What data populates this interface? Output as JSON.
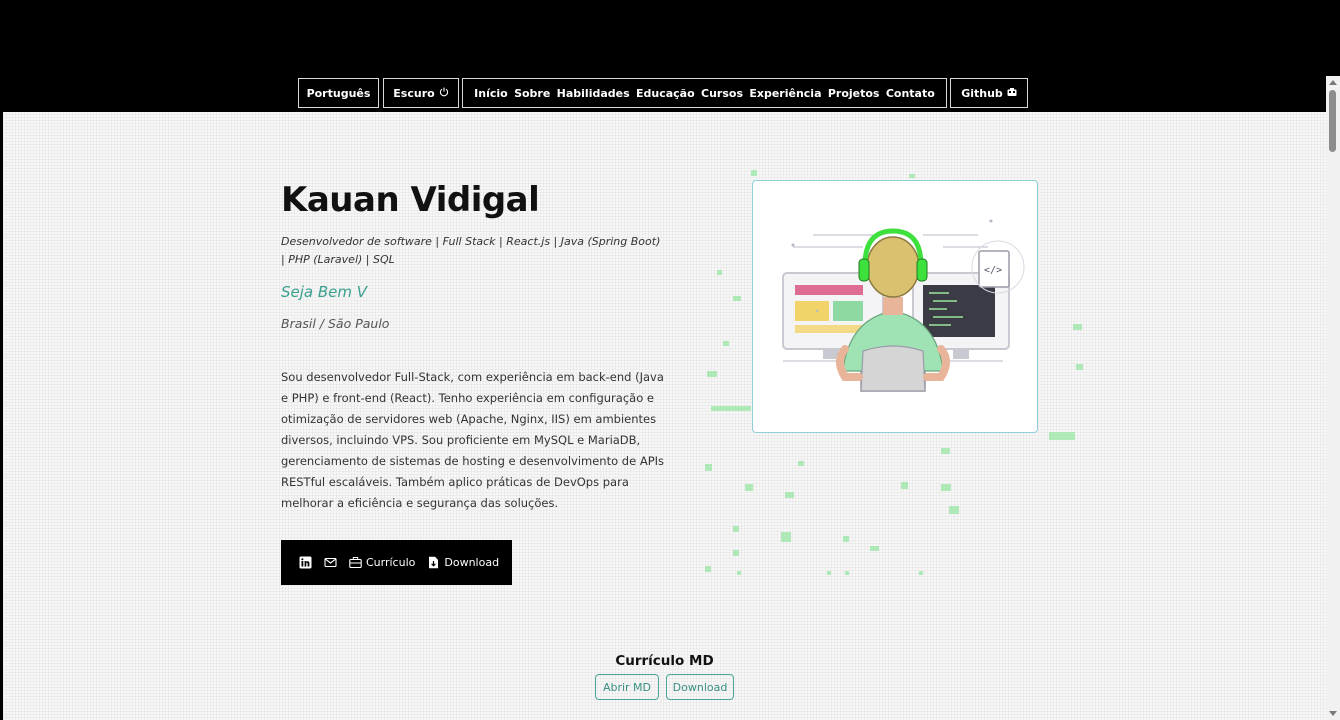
{
  "navbar": {
    "language": "Português",
    "theme": "Escuro",
    "theme_icon": "power-icon",
    "menu": [
      "Início",
      "Sobre",
      "Habilidades",
      "Educação",
      "Cursos",
      "Experiência",
      "Projetos",
      "Contato"
    ],
    "github": "Github",
    "github_icon": "github-icon"
  },
  "hero": {
    "name": "Kauan Vidigal",
    "subtitle": "Desenvolvedor de software | Full Stack | React.js | Java (Spring Boot) | PHP (Laravel) | SQL",
    "welcome": "Seja Bem V",
    "location": "Brasil / São Paulo",
    "bio": "Sou desenvolvedor Full-Stack, com experiência em back-end (Java e PHP) e front-end (React). Tenho experiência em configuração e otimização de servidores web (Apache, Nginx, IIS) em ambientes diversos, incluindo VPS. Sou proficiente em MySQL e MariaDB, gerenciamento de sistemas de hosting e desenvolvimento de APIs RESTful escaláveis. Também aplico práticas de DevOps para melhorar a eficiência e segurança das soluções."
  },
  "contact": {
    "linkedin_icon": "linkedin-icon",
    "email_icon": "mail-icon",
    "resume_label": "Currículo",
    "resume_icon": "briefcase-icon",
    "download_label": "Download",
    "download_icon": "file-download-icon"
  },
  "resume_md": {
    "title": "Currículo MD",
    "open_label": "Abrir MD",
    "download_label": "Download"
  },
  "colors": {
    "accent": "#3aa08f",
    "navbar_bg": "#000000",
    "particles": "#7be38a",
    "headphones": "#3ee03e"
  }
}
